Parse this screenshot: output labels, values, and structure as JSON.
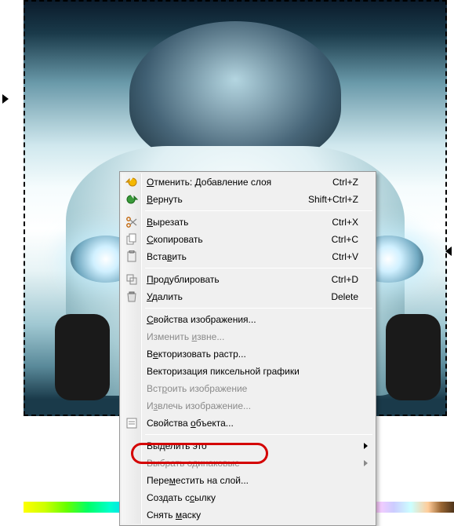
{
  "context_menu": {
    "items": [
      {
        "icon": "undo-arrow-icon",
        "label": "Отменить: Добавление слоя",
        "ul": 0,
        "shortcut": "Ctrl+Z",
        "enabled": true
      },
      {
        "icon": "redo-arrow-icon",
        "label": "Вернуть",
        "ul": 0,
        "shortcut": "Shift+Ctrl+Z",
        "enabled": true
      },
      {
        "sep": true
      },
      {
        "icon": "scissors-icon",
        "label": "Вырезать",
        "ul": 0,
        "shortcut": "Ctrl+X",
        "enabled": true
      },
      {
        "icon": "copy-pages-icon",
        "label": "Скопировать",
        "ul": 0,
        "shortcut": "Ctrl+C",
        "enabled": true
      },
      {
        "icon": "clipboard-icon",
        "label": "Вставить",
        "ul": 4,
        "shortcut": "Ctrl+V",
        "enabled": true
      },
      {
        "sep": true
      },
      {
        "icon": "duplicate-icon",
        "label": "Продублировать",
        "ul": 0,
        "shortcut": "Ctrl+D",
        "enabled": true
      },
      {
        "icon": "trash-icon",
        "label": "Удалить",
        "ul": 0,
        "shortcut": "Delete",
        "enabled": true
      },
      {
        "sep": true
      },
      {
        "icon": "",
        "label": "Свойства изображения...",
        "ul": 0,
        "enabled": true
      },
      {
        "icon": "",
        "label": "Изменить извне...",
        "ul": 9,
        "enabled": false
      },
      {
        "icon": "",
        "label": "Векторизовать растр...",
        "ul": 1,
        "enabled": true
      },
      {
        "icon": "",
        "label": "Векторизация пиксельной графики",
        "ul": -1,
        "enabled": true
      },
      {
        "icon": "",
        "label": "Встроить изображение",
        "ul": 3,
        "enabled": false
      },
      {
        "icon": "",
        "label": "Извлечь изображение...",
        "ul": 1,
        "enabled": false
      },
      {
        "icon": "properties-icon",
        "label": "Свойства объекта...",
        "ul": 9,
        "enabled": true
      },
      {
        "sep": true
      },
      {
        "icon": "",
        "label": "Выделить это",
        "ul": 2,
        "enabled": true,
        "arrow": true
      },
      {
        "icon": "",
        "label": "Выбрать одинаковые",
        "ul": -1,
        "enabled": false,
        "arrow": true
      },
      {
        "icon": "",
        "label": "Переместить на слой...",
        "ul": 4,
        "enabled": true,
        "highlight": true
      },
      {
        "icon": "",
        "label": "Создать ссылку",
        "ul": 9,
        "enabled": true
      },
      {
        "icon": "",
        "label": "Снять маску",
        "ul": 6,
        "enabled": true
      }
    ]
  }
}
